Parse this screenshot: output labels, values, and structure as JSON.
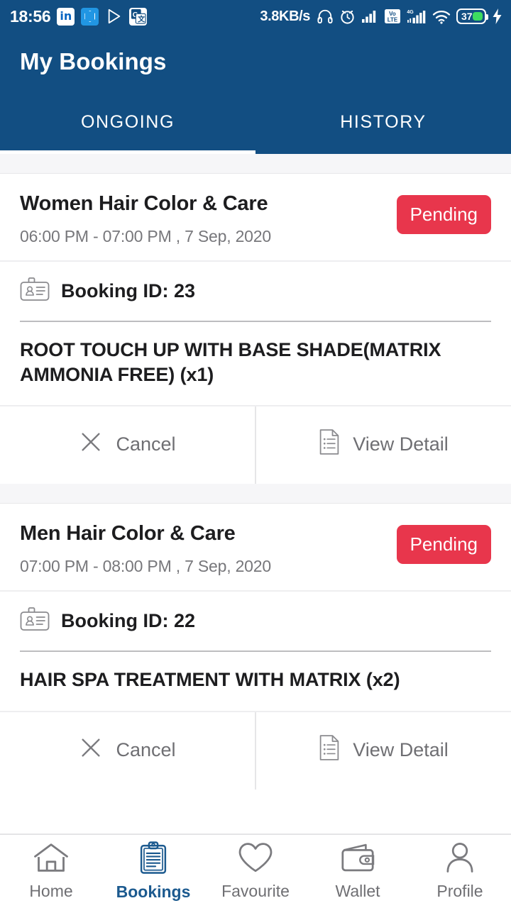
{
  "statusbar": {
    "time": "18:56",
    "network_speed": "3.8KB/s",
    "battery_level": "37",
    "app_icons": [
      "linkedin-icon",
      "mi-icon",
      "play-store-icon",
      "google-translate-icon"
    ],
    "status_icons": [
      "headphones-icon",
      "alarm-icon",
      "signal-icon",
      "volte-icon",
      "signal-4g-icon",
      "wifi-icon",
      "battery-icon",
      "charging-bolt-icon"
    ],
    "volte_label": "Vo LTE",
    "net_label": "4G"
  },
  "header": {
    "title": "My Bookings",
    "tabs": [
      {
        "label": "ONGOING",
        "selected": true
      },
      {
        "label": "HISTORY",
        "selected": false
      }
    ]
  },
  "bookings": [
    {
      "title": "Women Hair Color & Care",
      "time": "06:00 PM - 07:00 PM , 7 Sep, 2020",
      "status": "Pending",
      "booking_id_label": "Booking ID: 23",
      "services": "ROOT TOUCH UP WITH BASE SHADE(MATRIX AMMONIA FREE) (x1)",
      "cancel_label": "Cancel",
      "detail_label": "View Detail"
    },
    {
      "title": "Men Hair Color & Care",
      "time": "07:00 PM - 08:00 PM , 7 Sep, 2020",
      "status": "Pending",
      "booking_id_label": "Booking ID: 22",
      "services": "HAIR SPA TREATMENT WITH MATRIX (x2)",
      "cancel_label": "Cancel",
      "detail_label": "View Detail"
    }
  ],
  "bottom_nav": [
    {
      "label": "Home",
      "icon": "home-icon",
      "active": false
    },
    {
      "label": "Bookings",
      "icon": "clipboard-icon",
      "active": true
    },
    {
      "label": "Favourite",
      "icon": "heart-icon",
      "active": false
    },
    {
      "label": "Wallet",
      "icon": "wallet-icon",
      "active": false
    },
    {
      "label": "Profile",
      "icon": "person-icon",
      "active": false
    }
  ],
  "colors": {
    "primary": "#124e82",
    "accent_red": "#e8364c",
    "active_nav": "#1c5a8f"
  }
}
